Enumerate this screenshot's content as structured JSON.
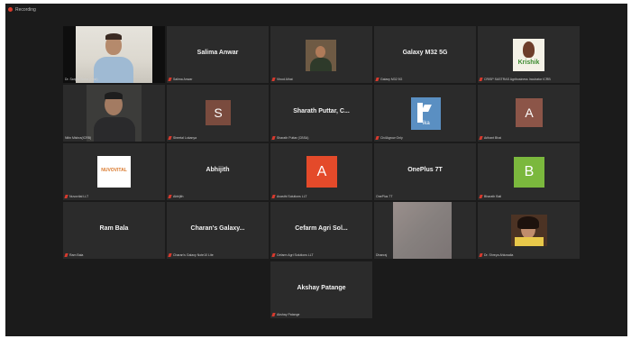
{
  "window": {
    "recording_label": "Recording"
  },
  "participants": [
    {
      "display": "",
      "label": "Dr. Sanjay Sinha (Host)",
      "avatar_letter": "",
      "avatar_color": "",
      "muted": false,
      "active_speaker": true
    },
    {
      "display": "Salima Anwar",
      "label": "Salima Anwar",
      "avatar_letter": "",
      "avatar_color": "",
      "muted": true,
      "active_speaker": false
    },
    {
      "display": "",
      "label": "Vinod Alhat",
      "avatar_letter": "",
      "avatar_color": "",
      "muted": true,
      "active_speaker": false
    },
    {
      "display": "Galaxy M32 5G",
      "label": "Galaxy M32 5G",
      "avatar_letter": "",
      "avatar_color": "",
      "muted": true,
      "active_speaker": false
    },
    {
      "display": "",
      "label": "CRISP SASTRAS Agribusiness Incubator ICRB",
      "avatar_letter": "",
      "avatar_color": "",
      "muted": true,
      "active_speaker": false
    },
    {
      "display": "",
      "label": "Nitin Mishra(ICRB)",
      "avatar_letter": "",
      "avatar_color": "",
      "muted": false,
      "active_speaker": false
    },
    {
      "display": "",
      "label": "Sheetal Lokanya",
      "avatar_letter": "S",
      "avatar_color": "#7a4b3e",
      "muted": true,
      "active_speaker": false
    },
    {
      "display": "Sharath Puttar, C...",
      "label": "Sharath Puttar (CBSA)",
      "avatar_letter": "",
      "avatar_color": "",
      "muted": true,
      "active_speaker": false
    },
    {
      "display": "",
      "label": "CivilAgrow Only",
      "avatar_letter": "",
      "avatar_color": "",
      "muted": true,
      "active_speaker": false
    },
    {
      "display": "",
      "label": "Arihant Bhai",
      "avatar_letter": "A",
      "avatar_color": "#8c5548",
      "muted": true,
      "active_speaker": false
    },
    {
      "display": "",
      "label": "Nuvovital LLT",
      "avatar_letter": "",
      "avatar_color": "",
      "muted": true,
      "active_speaker": false
    },
    {
      "display": "Abhijith",
      "label": "Abhijith",
      "avatar_letter": "",
      "avatar_color": "",
      "muted": true,
      "active_speaker": false
    },
    {
      "display": "",
      "label": "Avasthi Solutions LLT",
      "avatar_letter": "A",
      "avatar_color": "#e44a2a",
      "muted": true,
      "active_speaker": false
    },
    {
      "display": "OnePlus 7T",
      "label": "OnePlus 7T",
      "avatar_letter": "",
      "avatar_color": "",
      "muted": false,
      "active_speaker": false
    },
    {
      "display": "",
      "label": "Bharath Bali",
      "avatar_letter": "B",
      "avatar_color": "#7bb83d",
      "muted": true,
      "active_speaker": false
    },
    {
      "display": "Ram Bala",
      "label": "Ram Bala",
      "avatar_letter": "",
      "avatar_color": "",
      "muted": true,
      "active_speaker": false
    },
    {
      "display": "Charan's Galaxy...",
      "label": "Charan's Galaxy Note10 Lite",
      "avatar_letter": "",
      "avatar_color": "",
      "muted": true,
      "active_speaker": false
    },
    {
      "display": "Cefarm Agri Sol...",
      "label": "Cefarm Agri Solutions LLT",
      "avatar_letter": "",
      "avatar_color": "",
      "muted": true,
      "active_speaker": false
    },
    {
      "display": "",
      "label": "Dhanraj",
      "avatar_letter": "",
      "avatar_color": "",
      "muted": false,
      "active_speaker": false
    },
    {
      "display": "",
      "label": "Dr. Shreya Ahluwalia",
      "avatar_letter": "",
      "avatar_color": "",
      "muted": true,
      "active_speaker": false
    },
    {
      "display": "Akshay Patange",
      "label": "Akshay Patange",
      "avatar_letter": "",
      "avatar_color": "",
      "muted": true,
      "active_speaker": false
    }
  ],
  "logos": {
    "krishik": "Krishik",
    "nuvovital": "NUVOVITAL",
    "civil": "ika"
  }
}
